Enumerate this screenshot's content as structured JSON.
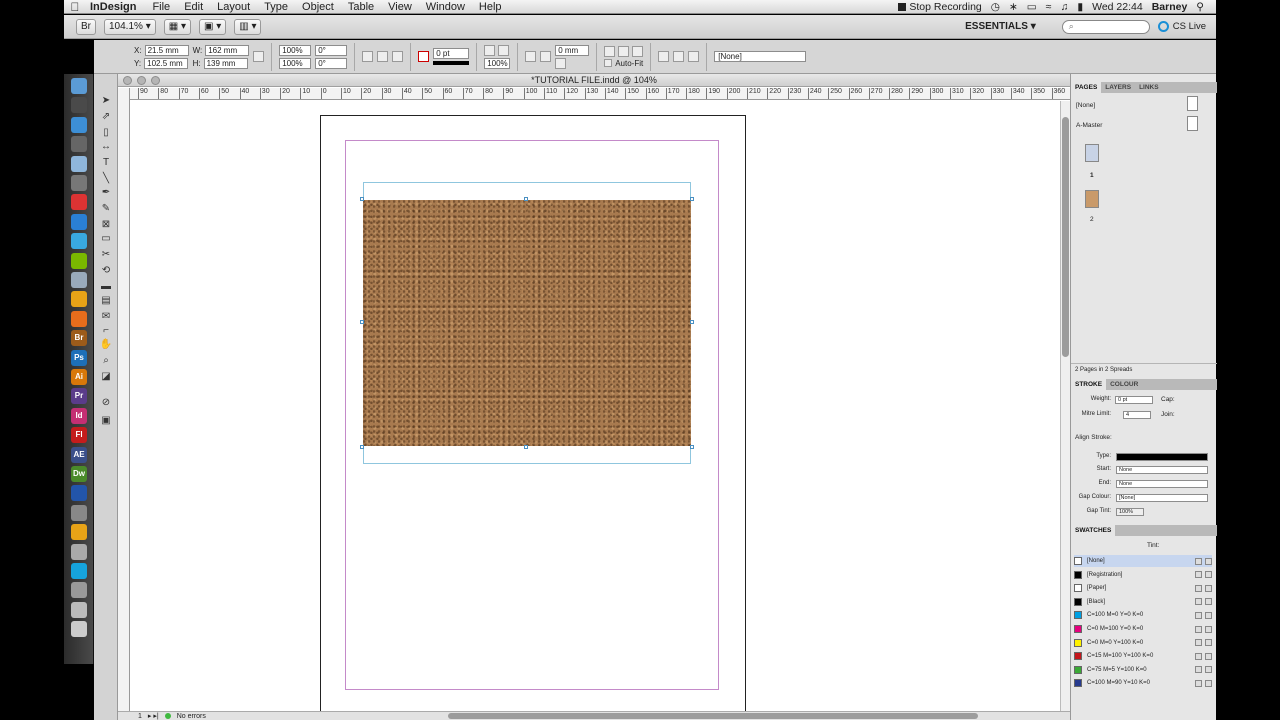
{
  "menubar": {
    "app_name": "InDesign",
    "items": [
      "File",
      "Edit",
      "Layout",
      "Type",
      "Object",
      "Table",
      "View",
      "Window",
      "Help"
    ],
    "recording": "Stop Recording",
    "clock": "Wed 22:44",
    "user": "Barney"
  },
  "appbar": {
    "zoom": "104.1%",
    "workspace": "ESSENTIALS",
    "cs_live": "CS Live"
  },
  "control": {
    "x": "21.5 mm",
    "y": "102.5 mm",
    "w": "162 mm",
    "h": "139 mm",
    "scale_x": "100%",
    "scale_y": "100%",
    "rotate": "0°",
    "shear": "0°",
    "stroke_weight": "0 pt",
    "opacity": "100%",
    "offset": "0 mm",
    "auto_fit": "Auto-Fit",
    "object_style": "[None]",
    "x_label": "X:",
    "y_label": "Y:",
    "w_label": "W:",
    "h_label": "H:"
  },
  "document": {
    "title": "*TUTORIAL FILE.indd @ 104%",
    "page_number": "1",
    "status": "No errors",
    "ruler_ticks": [
      "90",
      "80",
      "70",
      "60",
      "50",
      "40",
      "30",
      "20",
      "10",
      "0",
      "10",
      "20",
      "30",
      "40",
      "50",
      "60",
      "70",
      "80",
      "90",
      "100",
      "110",
      "120",
      "130",
      "140",
      "150",
      "160",
      "170",
      "180",
      "190",
      "200",
      "210",
      "220",
      "230",
      "240",
      "250",
      "260",
      "270",
      "280",
      "290",
      "300",
      "310",
      "320",
      "330",
      "340",
      "350",
      "360"
    ]
  },
  "pages_panel": {
    "tabs": [
      "PAGES",
      "LAYERS",
      "LINKS"
    ],
    "none_master": "[None]",
    "a_master": "A-Master",
    "page_labels": [
      "1",
      "2"
    ],
    "footer": "2 Pages in 2 Spreads"
  },
  "stroke_panel": {
    "tabs": [
      "STROKE",
      "COLOUR"
    ],
    "weight_label": "Weight:",
    "weight": "0 pt",
    "cap_label": "Cap:",
    "mitre_label": "Mitre Limit:",
    "mitre": "4",
    "join_label": "Join:",
    "align_label": "Align Stroke:",
    "type_label": "Type:",
    "start_label": "Start:",
    "start": "None",
    "end_label": "End:",
    "end": "None",
    "gap_colour_label": "Gap Colour:",
    "gap_colour": "[None]",
    "gap_tint_label": "Gap Tint:",
    "gap_tint": "100%"
  },
  "swatches_panel": {
    "title": "SWATCHES",
    "tint_label": "Tint:",
    "swatches": [
      {
        "name": "[None]",
        "color": "#ffffff",
        "selected": true
      },
      {
        "name": "[Registration]",
        "color": "#000000",
        "selected": false
      },
      {
        "name": "[Paper]",
        "color": "#ffffff",
        "selected": false
      },
      {
        "name": "[Black]",
        "color": "#000000",
        "selected": false
      },
      {
        "name": "C=100 M=0 Y=0 K=0",
        "color": "#00a0e3",
        "selected": false
      },
      {
        "name": "C=0 M=100 Y=0 K=0",
        "color": "#e5007e",
        "selected": false
      },
      {
        "name": "C=0 M=0 Y=100 K=0",
        "color": "#fff200",
        "selected": false
      },
      {
        "name": "C=15 M=100 Y=100 K=0",
        "color": "#c4161c",
        "selected": false
      },
      {
        "name": "C=75 M=5 Y=100 K=0",
        "color": "#3aa935",
        "selected": false
      },
      {
        "name": "C=100 M=90 Y=10 K=0",
        "color": "#263a8e",
        "selected": false
      }
    ]
  },
  "dock_icons": [
    {
      "name": "finder-icon",
      "color": "#5b9bd5"
    },
    {
      "name": "dashboard-icon",
      "color": "#4a4a4a"
    },
    {
      "name": "safari-icon",
      "color": "#3d8fd6"
    },
    {
      "name": "mission-control-icon",
      "color": "#666"
    },
    {
      "name": "mail-icon",
      "color": "#8fb6db"
    },
    {
      "name": "photo-icon",
      "color": "#777"
    },
    {
      "name": "calendar-icon",
      "color": "#d33"
    },
    {
      "name": "itunes-icon",
      "color": "#2a7fd4"
    },
    {
      "name": "twitter-icon",
      "color": "#39a9e0"
    },
    {
      "name": "spotify-icon",
      "color": "#7ab800"
    },
    {
      "name": "preview-icon",
      "color": "#9ab"
    },
    {
      "name": "chrome-icon",
      "color": "#e8a317"
    },
    {
      "name": "firefox-icon",
      "color": "#e76d1c"
    },
    {
      "name": "bridge-icon",
      "color": "#9c5b1a"
    },
    {
      "name": "photoshop-icon",
      "color": "#1d6fb8"
    },
    {
      "name": "illustrator-icon",
      "color": "#d8780a"
    },
    {
      "name": "premiere-icon",
      "color": "#5a3c8a"
    },
    {
      "name": "indesign-icon",
      "color": "#c42f73"
    },
    {
      "name": "flash-icon",
      "color": "#c41c1c"
    },
    {
      "name": "aftereffects-icon",
      "color": "#3a4f8a"
    },
    {
      "name": "dreamweaver-icon",
      "color": "#4a8a2a"
    },
    {
      "name": "acrobat-icon",
      "color": "#2255aa"
    },
    {
      "name": "system-prefs-icon",
      "color": "#888"
    },
    {
      "name": "vlc-icon",
      "color": "#e8a317"
    },
    {
      "name": "app-icon",
      "color": "#aaa"
    },
    {
      "name": "skype-icon",
      "color": "#16a4dd"
    },
    {
      "name": "downloads-icon",
      "color": "#999"
    },
    {
      "name": "documents-icon",
      "color": "#bbb"
    },
    {
      "name": "trash-icon",
      "color": "#ccc"
    }
  ],
  "dock_labels": {
    "bridge": "Br",
    "photoshop": "Ps",
    "illustrator": "Ai",
    "premiere": "Pr",
    "indesign": "Id",
    "flash": "Fl",
    "aftereffects": "AE",
    "dreamweaver": "Dw"
  }
}
